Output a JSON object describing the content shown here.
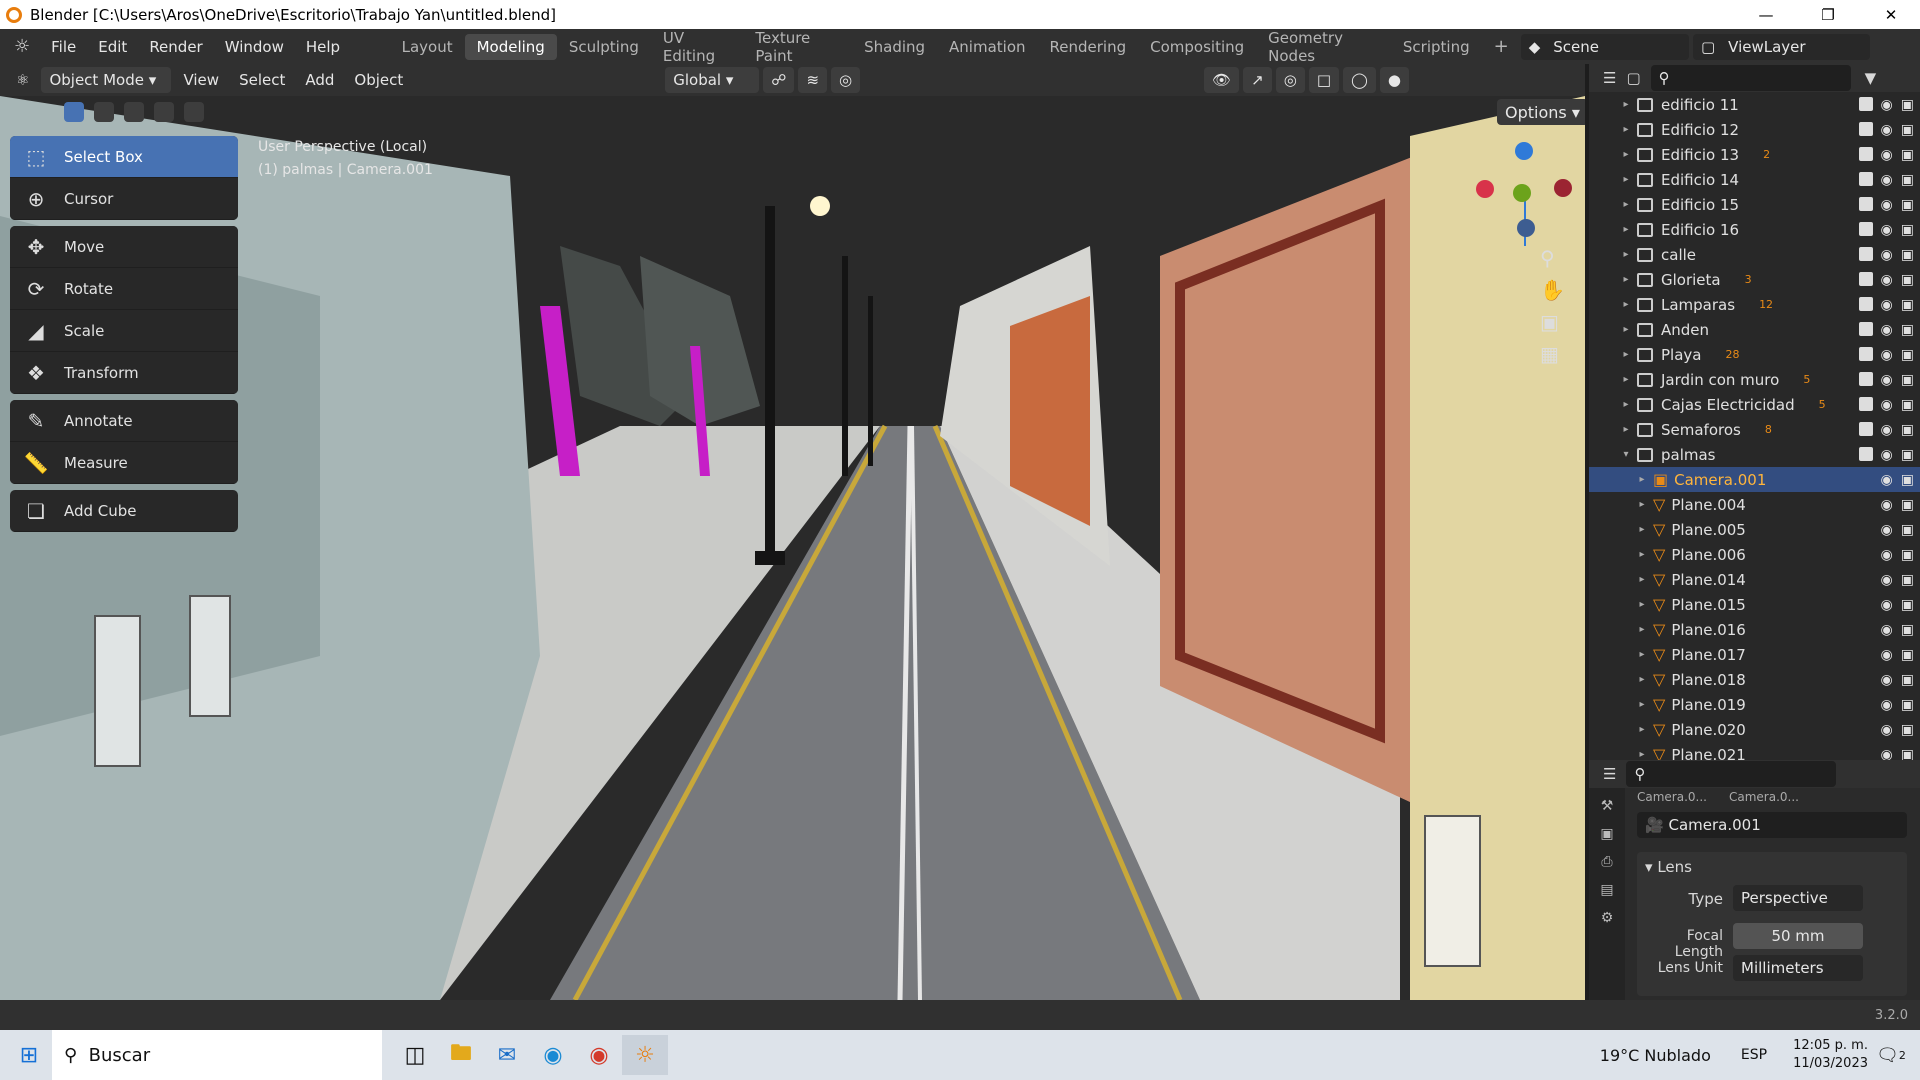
{
  "window": {
    "title": "Blender [C:\\Users\\Aros\\OneDrive\\Escritorio\\Trabajo Yan\\untitled.blend]"
  },
  "menu": [
    "File",
    "Edit",
    "Render",
    "Window",
    "Help"
  ],
  "workspaces": [
    "Layout",
    "Modeling",
    "Sculpting",
    "UV Editing",
    "Texture Paint",
    "Shading",
    "Animation",
    "Rendering",
    "Compositing",
    "Geometry Nodes",
    "Scripting"
  ],
  "active_workspace": "Modeling",
  "scene": "Scene",
  "viewlayer": "ViewLayer",
  "header": {
    "mode": "Object Mode",
    "view": "View",
    "select": "Select",
    "add": "Add",
    "object": "Object",
    "transform": "Global",
    "options": "Options"
  },
  "viewport": {
    "line1": "User Perspective (Local)",
    "line2": "(1) palmas | Camera.001"
  },
  "tools": [
    {
      "label": "Select Box",
      "icon": "select-box-icon"
    },
    {
      "label": "Cursor",
      "icon": "cursor-icon"
    },
    {
      "label": "Move",
      "icon": "move-icon"
    },
    {
      "label": "Rotate",
      "icon": "rotate-icon"
    },
    {
      "label": "Scale",
      "icon": "scale-icon"
    },
    {
      "label": "Transform",
      "icon": "transform-icon"
    },
    {
      "label": "Annotate",
      "icon": "annotate-icon"
    },
    {
      "label": "Measure",
      "icon": "measure-icon"
    },
    {
      "label": "Add Cube",
      "icon": "add-cube-icon"
    }
  ],
  "outliner": [
    {
      "name": "edificio 11",
      "type": "collection",
      "badge": ""
    },
    {
      "name": "Edificio 12",
      "type": "collection",
      "badge": ""
    },
    {
      "name": "Edificio 13",
      "type": "collection",
      "badge": "2"
    },
    {
      "name": "Edificio 14",
      "type": "collection",
      "badge": ""
    },
    {
      "name": "Edificio 15",
      "type": "collection",
      "badge": ""
    },
    {
      "name": "Edificio 16",
      "type": "collection",
      "badge": ""
    },
    {
      "name": "calle",
      "type": "collection",
      "badge": ""
    },
    {
      "name": "Glorieta",
      "type": "collection",
      "badge": "3"
    },
    {
      "name": "Lamparas",
      "type": "collection",
      "badge": "12"
    },
    {
      "name": "Anden",
      "type": "collection",
      "badge": ""
    },
    {
      "name": "Playa",
      "type": "collection",
      "badge": "28"
    },
    {
      "name": "Jardin con muro",
      "type": "collection",
      "badge": "5"
    },
    {
      "name": "Cajas Electricidad",
      "type": "collection",
      "badge": "5"
    },
    {
      "name": "Semaforos",
      "type": "collection",
      "badge": "8"
    },
    {
      "name": "palmas",
      "type": "collection-open",
      "badge": ""
    },
    {
      "name": "Camera.001",
      "type": "camera",
      "badge": ""
    },
    {
      "name": "Plane.004",
      "type": "mesh",
      "badge": ""
    },
    {
      "name": "Plane.005",
      "type": "mesh",
      "badge": ""
    },
    {
      "name": "Plane.006",
      "type": "mesh",
      "badge": ""
    },
    {
      "name": "Plane.014",
      "type": "mesh",
      "badge": ""
    },
    {
      "name": "Plane.015",
      "type": "mesh",
      "badge": ""
    },
    {
      "name": "Plane.016",
      "type": "mesh",
      "badge": ""
    },
    {
      "name": "Plane.017",
      "type": "mesh",
      "badge": ""
    },
    {
      "name": "Plane.018",
      "type": "mesh",
      "badge": ""
    },
    {
      "name": "Plane.019",
      "type": "mesh",
      "badge": ""
    },
    {
      "name": "Plane.020",
      "type": "mesh",
      "badge": ""
    },
    {
      "name": "Plane.021",
      "type": "mesh",
      "badge": ""
    }
  ],
  "properties": {
    "breadcrumb": [
      "Camera.0...",
      "Camera.0..."
    ],
    "object_name": "Camera.001",
    "panel": "Lens",
    "type_label": "Type",
    "type_value": "Perspective",
    "focal_label": "Focal Length",
    "focal_value": "50 mm",
    "unit_label": "Lens Unit",
    "unit_value": "Millimeters"
  },
  "version": "3.2.0",
  "taskbar": {
    "search": "Buscar",
    "weather": "19°C  Nublado",
    "lang": "ESP",
    "time": "12:05 p. m.",
    "date": "11/03/2023",
    "notif": "2"
  }
}
